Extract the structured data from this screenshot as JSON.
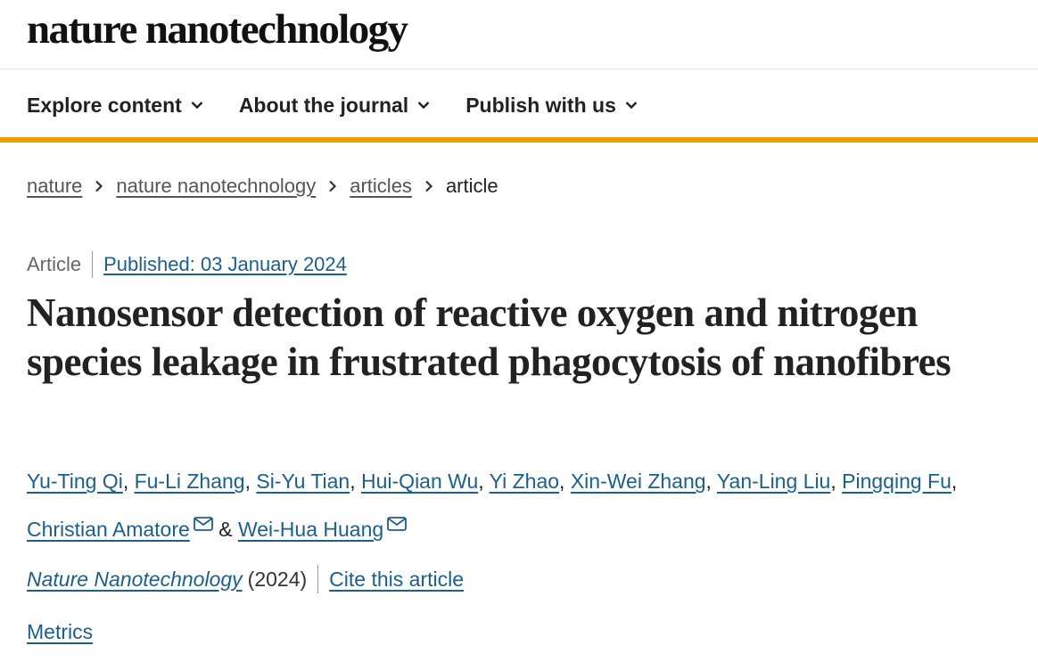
{
  "masthead": {
    "logo": "nature nanotechnology"
  },
  "nav": {
    "items": [
      {
        "label": "Explore content"
      },
      {
        "label": "About the journal"
      },
      {
        "label": "Publish with us"
      }
    ]
  },
  "breadcrumb": {
    "items": [
      "nature",
      "nature nanotechnology",
      "articles"
    ],
    "current": "article"
  },
  "article": {
    "type": "Article",
    "published": "Published: 03 January 2024",
    "title": "Nanosensor detection of reactive oxygen and nitrogen species leakage in frustrated phagocytosis of nanofibres",
    "authors": [
      "Yu-Ting Qi",
      "Fu-Li Zhang",
      "Si-Yu Tian",
      "Hui-Qian Wu",
      "Yi Zhao",
      "Xin-Wei Zhang",
      "Yan-Ling Liu",
      "Pingqing Fu",
      "Christian Amatore",
      "Wei-Hua Huang"
    ],
    "author_separator": ", ",
    "author_conjunction": " & ",
    "journal": "Nature Nanotechnology",
    "year": "(2024)",
    "cite": "Cite this article",
    "metrics": "Metrics"
  },
  "colors": {
    "link": "#1b5f8c",
    "accent_bar": "#e8a000",
    "text": "#222222"
  }
}
